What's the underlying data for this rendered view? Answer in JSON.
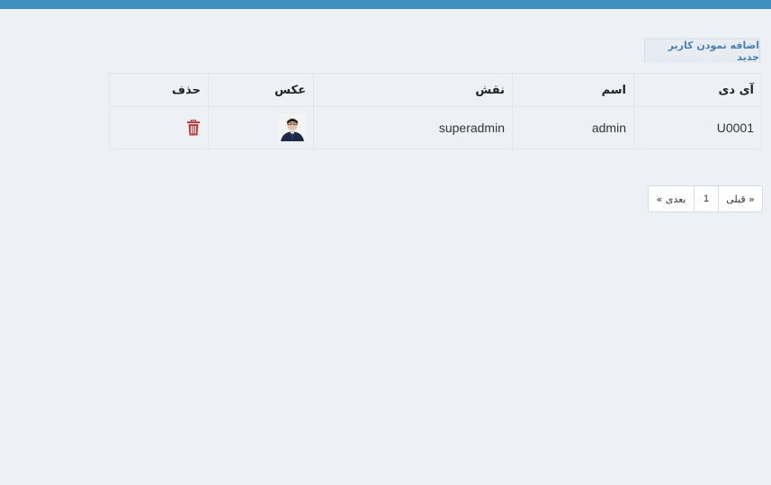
{
  "header": {
    "accent_color": "#3f8fc1"
  },
  "actions": {
    "add_user_label": "اضافه نمودن کاربر جدید"
  },
  "table": {
    "headers": {
      "id": "آی دی",
      "name": "اسم",
      "role": "نقش",
      "photo": "عکس",
      "delete": "حذف"
    },
    "rows": [
      {
        "id": "U0001",
        "name": "admin",
        "role": "superadmin",
        "photo_icon": "user-photo",
        "delete_icon": "trash-icon"
      }
    ]
  },
  "pagination": {
    "prev_label": "« قبلی",
    "page": "1",
    "next_label": "بعدی »"
  }
}
